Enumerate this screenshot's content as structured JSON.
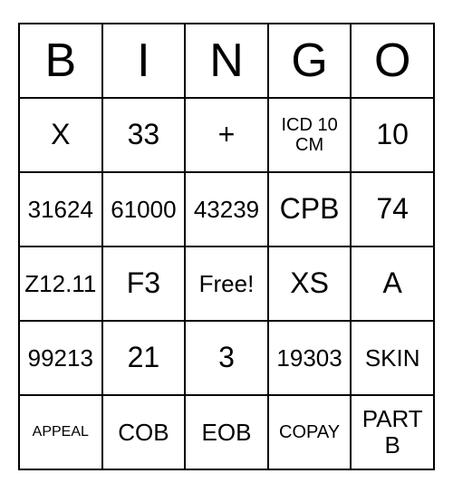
{
  "headers": [
    "B",
    "I",
    "N",
    "G",
    "O"
  ],
  "rows": [
    [
      {
        "text": "X",
        "cls": "fs-big"
      },
      {
        "text": "33",
        "cls": "fs-big"
      },
      {
        "text": "+",
        "cls": "fs-big"
      },
      {
        "text": "ICD 10 CM",
        "cls": "fs-med"
      },
      {
        "text": "10",
        "cls": "fs-big"
      }
    ],
    [
      {
        "text": "31624",
        "cls": ""
      },
      {
        "text": "61000",
        "cls": ""
      },
      {
        "text": "43239",
        "cls": ""
      },
      {
        "text": "CPB",
        "cls": "fs-big"
      },
      {
        "text": "74",
        "cls": "fs-big"
      }
    ],
    [
      {
        "text": "Z12.11",
        "cls": ""
      },
      {
        "text": "F3",
        "cls": "fs-big"
      },
      {
        "text": "Free!",
        "cls": ""
      },
      {
        "text": "XS",
        "cls": "fs-big"
      },
      {
        "text": "A",
        "cls": "fs-big"
      }
    ],
    [
      {
        "text": "99213",
        "cls": ""
      },
      {
        "text": "21",
        "cls": "fs-big"
      },
      {
        "text": "3",
        "cls": "fs-big"
      },
      {
        "text": "19303",
        "cls": ""
      },
      {
        "text": "SKIN",
        "cls": ""
      }
    ],
    [
      {
        "text": "APPEAL",
        "cls": "fs-small"
      },
      {
        "text": "COB",
        "cls": ""
      },
      {
        "text": "EOB",
        "cls": ""
      },
      {
        "text": "COPAY",
        "cls": "fs-med"
      },
      {
        "text": "PART B",
        "cls": ""
      }
    ]
  ]
}
